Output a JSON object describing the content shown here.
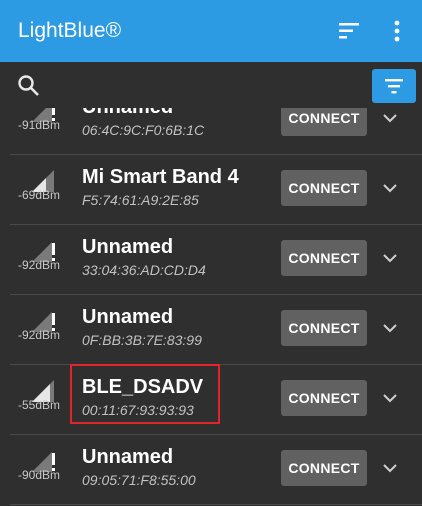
{
  "app": {
    "title": "LightBlue®"
  },
  "devices": [
    {
      "rssi": "-91dBm",
      "name": "Unnamed",
      "address": "06:4C:9C:F0:6B:1C",
      "action": "CONNECT"
    },
    {
      "rssi": "-69dBm",
      "name": "Mi Smart Band 4",
      "address": "F5:74:61:A9:2E:85",
      "action": "CONNECT"
    },
    {
      "rssi": "-92dBm",
      "name": "Unnamed",
      "address": "33:04:36:AD:CD:D4",
      "action": "CONNECT"
    },
    {
      "rssi": "-92dBm",
      "name": "Unnamed",
      "address": "0F:BB:3B:7E:83:99",
      "action": "CONNECT"
    },
    {
      "rssi": "-55dBm",
      "name": "BLE_DSADV",
      "address": "00:11:67:93:93:93",
      "action": "CONNECT"
    },
    {
      "rssi": "-90dBm",
      "name": "Unnamed",
      "address": "09:05:71:F8:55:00",
      "action": "CONNECT"
    }
  ],
  "icons": {
    "sort": "sort-icon",
    "more": "more-vert-icon",
    "search": "search-icon",
    "filter": "filter-icon",
    "signal": "signal-icon",
    "expand": "chevron-down-icon"
  },
  "colors": {
    "app_bar": "#2d9be3",
    "background": "#2f2f2f",
    "connect_button": "#616161",
    "highlight": "#e0242a"
  }
}
